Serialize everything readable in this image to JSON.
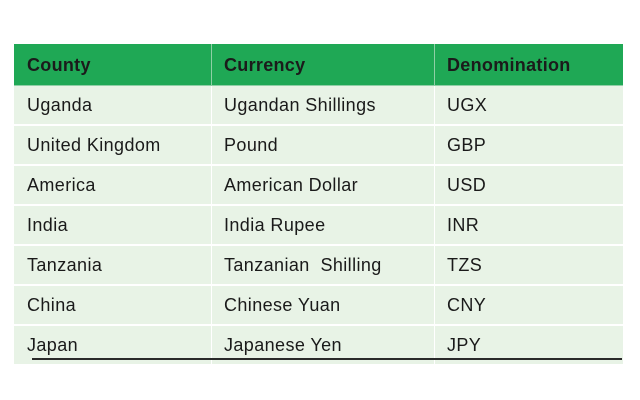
{
  "table": {
    "headers": [
      "County",
      "Currency",
      "Denomination"
    ],
    "rows": [
      [
        "Uganda",
        "Ugandan Shillings",
        "UGX"
      ],
      [
        "United Kingdom",
        "Pound",
        "GBP"
      ],
      [
        "America",
        "American Dollar",
        "USD"
      ],
      [
        "India",
        "India Rupee",
        "INR"
      ],
      [
        "Tanzania",
        "Tanzanian  Shilling",
        "TZS"
      ],
      [
        "China",
        "Chinese Yuan",
        "CNY"
      ],
      [
        "Japan",
        "Japanese Yen",
        "JPY"
      ]
    ]
  },
  "colors": {
    "header_bg": "#1fa855",
    "row_bg": "#e8f3e6"
  }
}
